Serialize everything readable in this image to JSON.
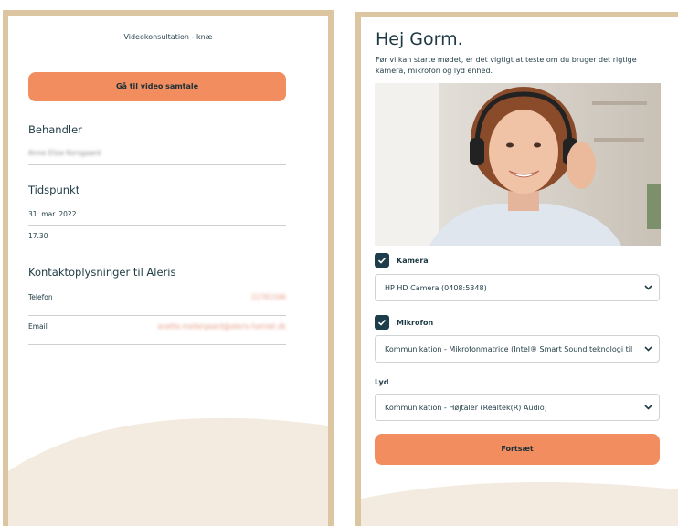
{
  "left": {
    "title": "Videokonsultation - knæ",
    "video_button": "Gå til video samtale",
    "practitioner_heading": "Behandler",
    "practitioner_name": "Anne Elize Korsgaard",
    "time_heading": "Tidspunkt",
    "date": "31. mar. 2022",
    "time": "17.30",
    "contact_heading": "Kontaktoplysninger til Aleris",
    "phone_label": "Telefon",
    "phone_value": "22781596",
    "email_label": "Email",
    "email_value": "anette.mellergaard@aleris-hamlet.dk"
  },
  "right": {
    "greeting": "Hej Gorm.",
    "intro": "Før vi kan starte mødet, er det vigtigt at teste om du bruger det rigtige kamera, mikrofon og lyd enhed.",
    "camera_label": "Kamera",
    "camera_checked": true,
    "camera_device": "HP HD Camera (0408:5348)",
    "mic_label": "Mikrofon",
    "mic_checked": true,
    "mic_device": "Kommunikation - Mikrofonmatrice (Intel® Smart Sound teknologi til",
    "sound_label": "Lyd",
    "sound_device": "Kommunikation - Højtaler (Realtek(R) Audio)",
    "continue_button": "Fortsæt"
  },
  "colors": {
    "accent": "#f28d5f",
    "frame": "#dcc5a1",
    "checkbox": "#1d3d4a",
    "text": "#1f3b45",
    "wave": "#f3ebe0"
  },
  "icons": [
    "check-icon",
    "chevron-down-icon"
  ]
}
